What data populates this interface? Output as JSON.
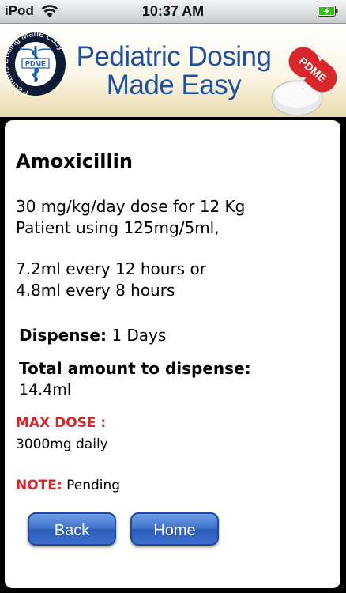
{
  "status_bar": {
    "carrier": "iPod",
    "time": "10:37 AM",
    "wifi_icon": "wifi-icon",
    "battery_icon": "battery-charging-icon"
  },
  "header": {
    "title_line1": "Pediatric Dosing",
    "title_line2": "Made Easy",
    "logo_ring_text": "Pediatric Dosing Made Easy",
    "logo_badge": "PDME",
    "pill_label": "PDME",
    "colors": {
      "title": "#21519e",
      "logo_ring": "#0d1a33",
      "pill": "#d8262a"
    }
  },
  "content": {
    "drug_name": "Amoxicillin",
    "dose_text": "30 mg/kg/day dose for 12 Kg\nPatient using 125mg/5ml,",
    "regimen_text": "7.2ml every 12 hours or\n4.8ml every 8 hours",
    "dispense_label": "Dispense:",
    "dispense_value": "1 Days",
    "total_label": "Total amount to dispense:",
    "total_value": "14.4ml",
    "max_dose_label": "MAX DOSE :",
    "max_dose_value": "3000mg daily",
    "note_label": "NOTE:",
    "note_value": "Pending"
  },
  "buttons": {
    "back": "Back",
    "home": "Home"
  },
  "colors": {
    "accent_red": "#d8262a",
    "button_blue": "#3f73cc"
  }
}
